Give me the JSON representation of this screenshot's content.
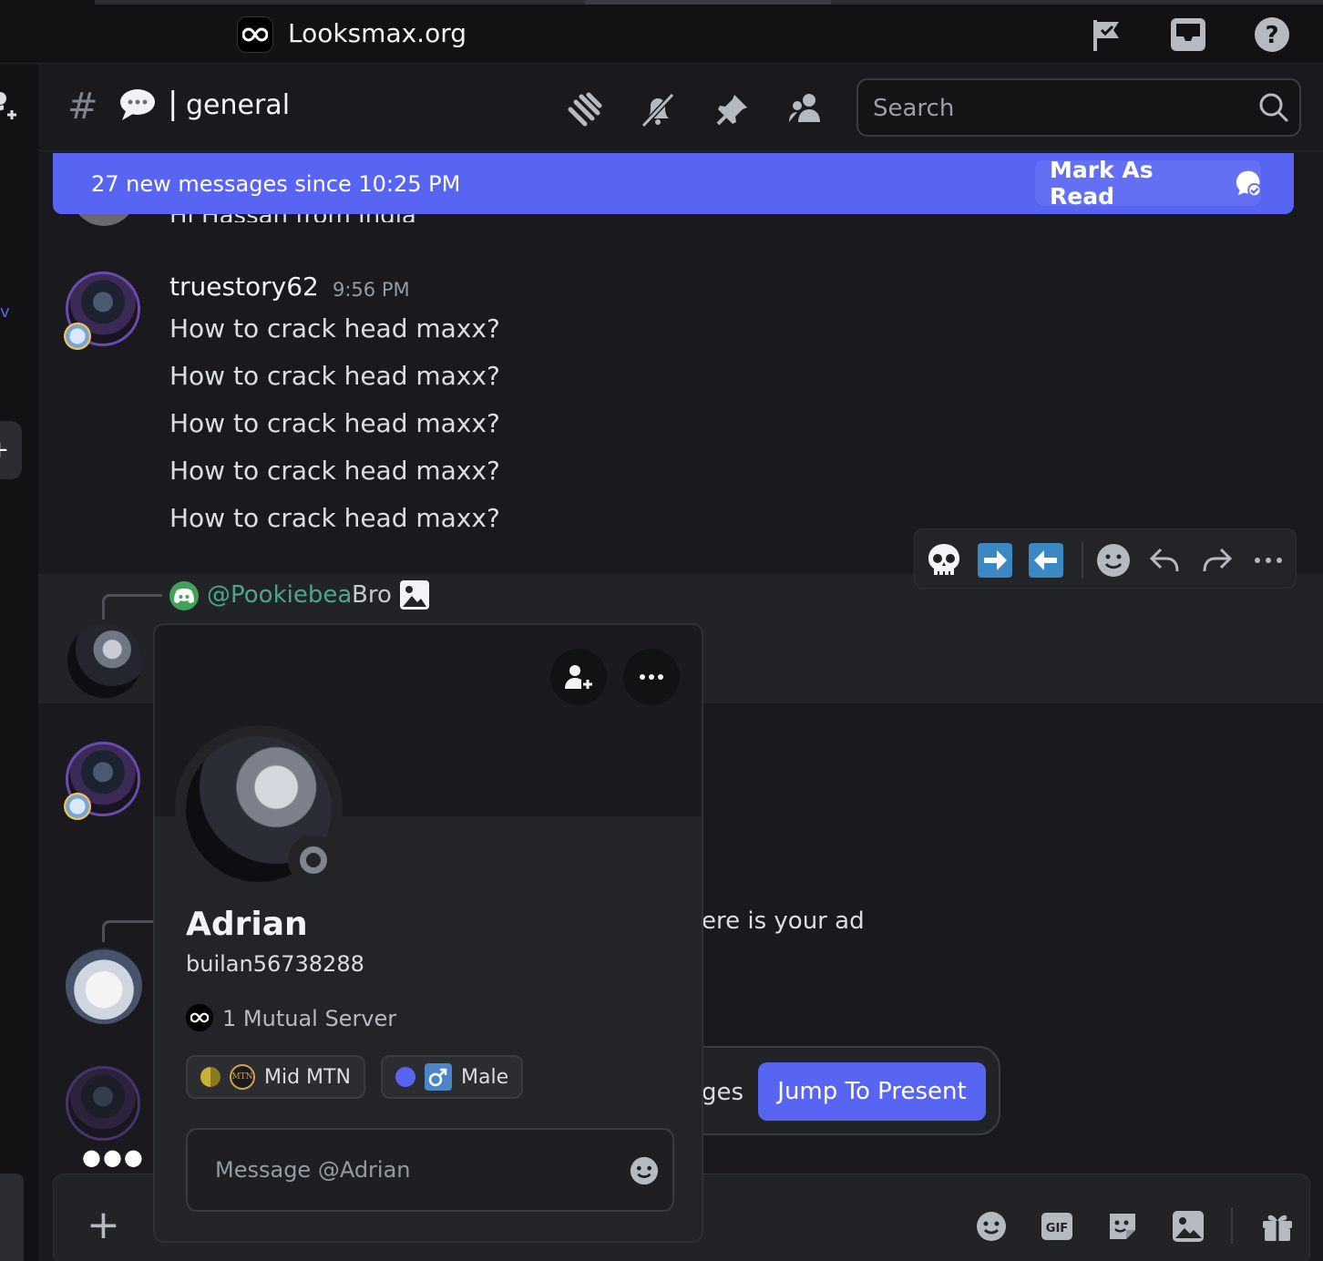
{
  "titlebar": {
    "server_name": "Looksmax.org"
  },
  "channel": {
    "name": "general",
    "search_placeholder": "Search"
  },
  "new_messages": {
    "text": "27 new messages since 10:25 PM",
    "mark_read": "Mark As Read"
  },
  "peek_message": "Hi Hassan from India",
  "message": {
    "author": "truestory62",
    "time": "9:56 PM",
    "lines": [
      "How to crack head maxx?",
      "How to crack head maxx?",
      "How to crack head maxx?",
      "How to crack head maxx?",
      "How to crack head maxx?"
    ]
  },
  "reply": {
    "mention": "@Pookiebea",
    "text": "Bro"
  },
  "partial_message": "ere is your ad",
  "jump": {
    "partial": "ges",
    "button": "Jump To Present"
  },
  "typing_indicator": "●●●",
  "composer": {
    "plus": "+",
    "gif_label": "GIF"
  },
  "profile": {
    "display_name": "Adrian",
    "username": "builan56738288",
    "mutual_servers": "1 Mutual Server",
    "roles": [
      {
        "label": "Mid MTN",
        "color": "#c9b037",
        "badge": "MTN"
      },
      {
        "label": "Male",
        "color": "#5865f2",
        "badge": "♂"
      }
    ],
    "message_placeholder": "Message @Adrian"
  },
  "colors": {
    "accent": "#5865f2",
    "mention": "#4ea58a",
    "status_offline": "#80848e"
  }
}
